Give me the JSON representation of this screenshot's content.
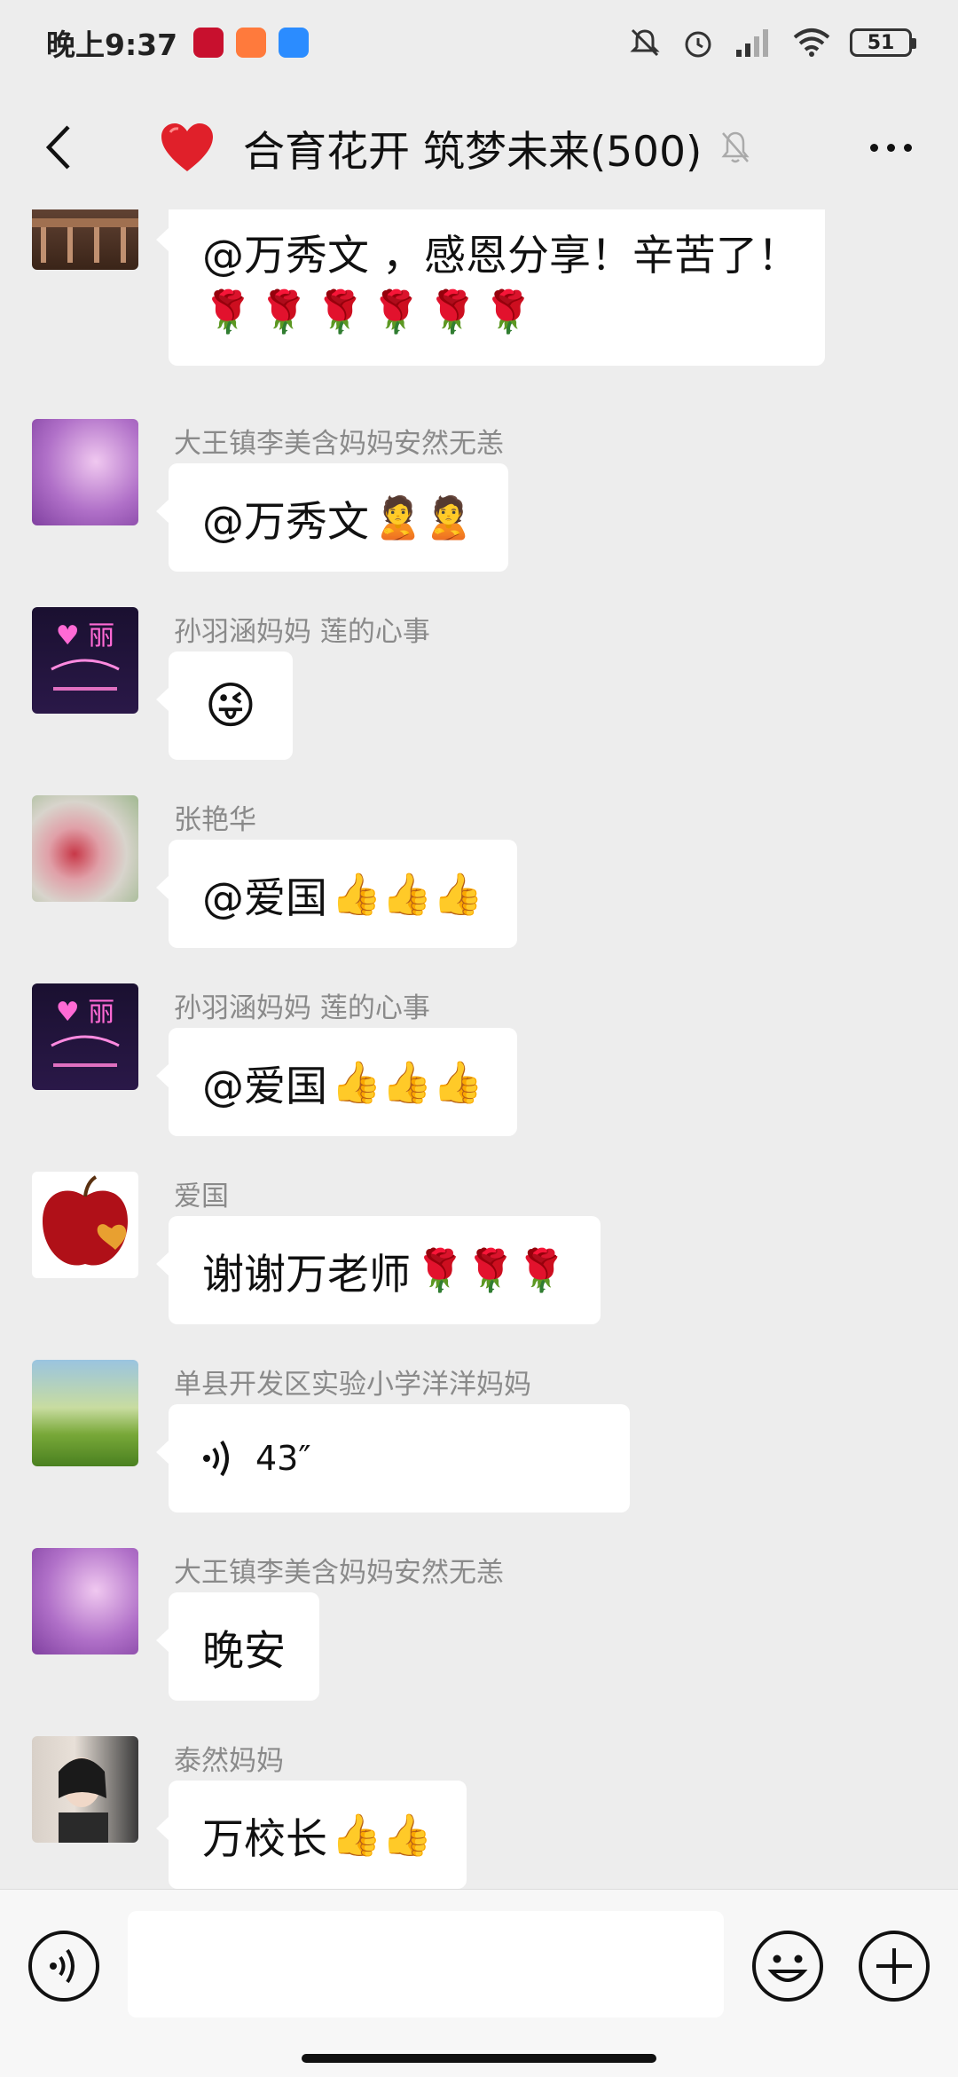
{
  "status": {
    "time": "晚上9:37",
    "battery": "51"
  },
  "header": {
    "title": "合育花开 筑梦未来(500)"
  },
  "messages": [
    {
      "sender": "",
      "text": "@万秀文 ，感恩分享！辛苦了！",
      "emoji": "🌹🌹🌹🌹🌹🌹"
    },
    {
      "sender": "大王镇李美含妈妈安然无恙",
      "text": "@万秀文 ",
      "emoji": "🙎🙎"
    },
    {
      "sender": "孙羽涵妈妈  莲的心事",
      "text": "",
      "emoji": "😜"
    },
    {
      "sender": "张艳华",
      "text": "@爱国 ",
      "emoji": "👍👍👍"
    },
    {
      "sender": "孙羽涵妈妈  莲的心事",
      "text": "@爱国 ",
      "emoji": "👍👍👍"
    },
    {
      "sender": "爱国",
      "text": "谢谢万老师",
      "emoji": "🌹🌹🌹"
    },
    {
      "sender": "单县开发区实验小学洋洋妈妈",
      "text": "43″",
      "emoji": ""
    },
    {
      "sender": "大王镇李美含妈妈安然无恙",
      "text": "晚安",
      "emoji": ""
    },
    {
      "sender": "泰然妈妈",
      "text": "万校长",
      "emoji": "👍👍"
    }
  ],
  "input": {
    "placeholder": ""
  },
  "colors": {
    "background": "#ededed",
    "bubble": "#ffffff",
    "sender": "#8a8a8a"
  }
}
